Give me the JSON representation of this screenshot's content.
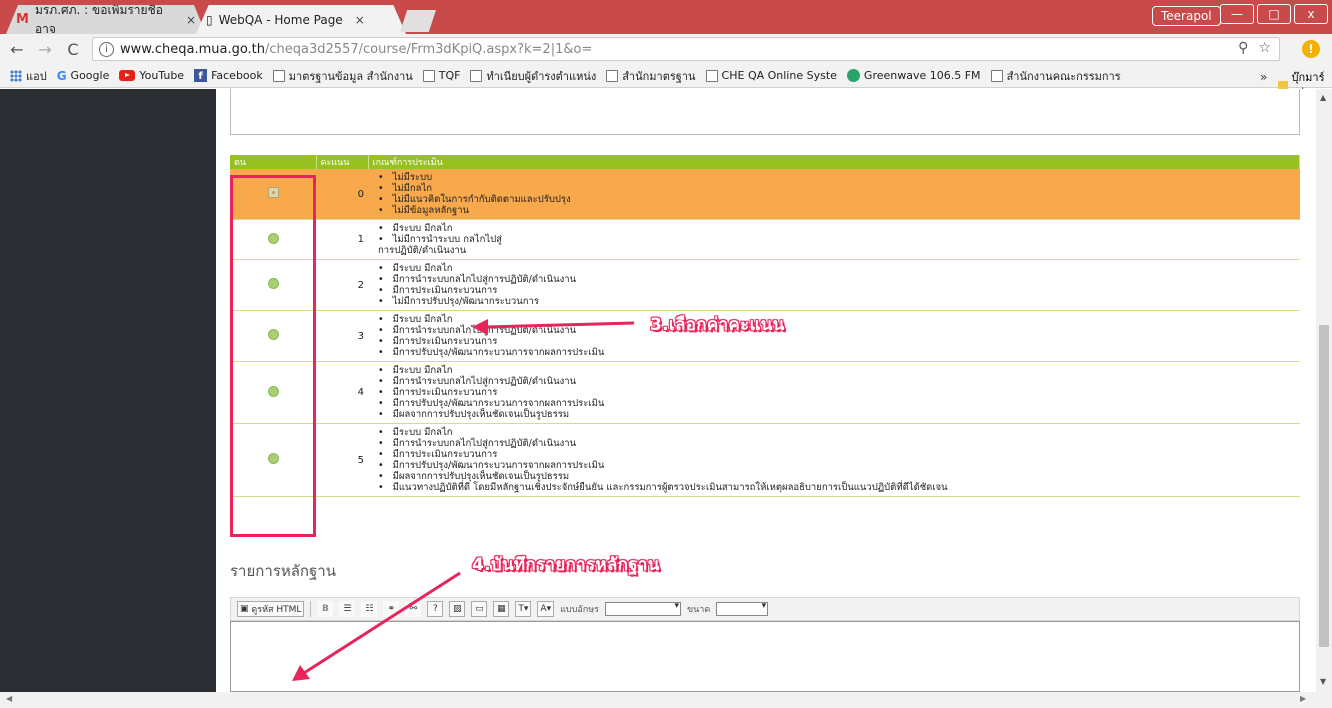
{
  "browser": {
    "tab_inactive_title": "มรภ.ศภ. : ขอเพิ่มรายชื่ออาจ",
    "tab_active_title": "WebQA - Home Page",
    "tab_close": "×",
    "user_name": "Teerapol",
    "win_min": "—",
    "win_max": "□",
    "win_close": "x",
    "url_host": "www.cheqa.mua.go.th",
    "url_path": "/cheqa3d2557/course/Frm3dKpiQ.aspx?k=2|1&o=",
    "bookmarks": [
      {
        "label": "แอป",
        "icon": "apps-grid-icon"
      },
      {
        "label": "Google",
        "icon": "google-icon"
      },
      {
        "label": "YouTube",
        "icon": "youtube-icon"
      },
      {
        "label": "Facebook",
        "icon": "facebook-icon"
      },
      {
        "label": "มาตรฐานข้อมูล สำนักงาน",
        "icon": "page-icon"
      },
      {
        "label": "TQF",
        "icon": "page-icon"
      },
      {
        "label": "ทำเนียบผู้ดำรงตำแหน่ง",
        "icon": "page-icon"
      },
      {
        "label": "สำนักมาตรฐาน",
        "icon": "page-icon"
      },
      {
        "label": "CHE QA Online Syste",
        "icon": "page-icon"
      },
      {
        "label": "Greenwave 106.5 FM",
        "icon": "greenwave-icon"
      },
      {
        "label": "สำนักงานคณะกรรมการ",
        "icon": "page-icon"
      }
    ],
    "bookmarks_more": "»",
    "bookmarks_other": "บุ๊กมาร์กอื่นๆ"
  },
  "table": {
    "headers": [
      "ตน",
      "คะแนน",
      "เกณฑ์การประเมิน"
    ],
    "rows": [
      {
        "score": "0",
        "selected": true,
        "items": [
          "ไม่มีระบบ",
          "ไม่มีกลไก",
          "ไม่มีแนวคิดในการกำกับติดตามและปรับปรุง",
          "ไม่มีข้อมูลหลักฐาน"
        ],
        "tail": ""
      },
      {
        "score": "1",
        "selected": false,
        "items": [
          "มีระบบ มีกลไก",
          "ไม่มีการนำระบบ กลไกไปสู่"
        ],
        "tail": "การปฏิบัติ/ดำเนินงาน"
      },
      {
        "score": "2",
        "selected": false,
        "items": [
          "มีระบบ มีกลไก",
          "มีการนำระบบกลไกไปสู่การปฏิบัติ/ดำเนินงาน",
          "มีการประเมินกระบวนการ",
          "ไม่มีการปรับปรุง/พัฒนากระบวนการ"
        ],
        "tail": ""
      },
      {
        "score": "3",
        "selected": false,
        "items": [
          "มีระบบ มีกลไก",
          "มีการนำระบบกลไกไปสู่การปฏิบัติ/ดำเนินงาน",
          "มีการประเมินกระบวนการ",
          "มีการปรับปรุง/พัฒนากระบวนการจากผลการประเมิน"
        ],
        "tail": ""
      },
      {
        "score": "4",
        "selected": false,
        "items": [
          "มีระบบ มีกลไก",
          "มีการนำระบบกลไกไปสู่การปฏิบัติ/ดำเนินงาน",
          "มีการประเมินกระบวนการ",
          "มีการปรับปรุง/พัฒนากระบวนการจากผลการประเมิน",
          "มีผลจากการปรับปรุงเห็นชัดเจนเป็นรูปธรรม"
        ],
        "tail": ""
      },
      {
        "score": "5",
        "selected": false,
        "items": [
          "มีระบบ มีกลไก",
          "มีการนำระบบกลไกไปสู่การปฏิบัติ/ดำเนินงาน",
          "มีการประเมินกระบวนการ",
          "มีการปรับปรุง/พัฒนากระบวนการจากผลการประเมิน",
          "มีผลจากการปรับปรุงเห็นชัดเจนเป็นรูปธรรม",
          "มีแนวทางปฏิบัติที่ดี โดยมีหลักฐานเชิงประจักษ์ยืนยัน และกรรมการผู้ตรวจประเมินสามารถให้เหตุผลอธิบายการเป็นแนวปฏิบัติที่ดีได้ชัดเจน"
        ],
        "tail": ""
      }
    ]
  },
  "evidence_label": "รายการหลักฐาน",
  "editor": {
    "html_button": "ดูรหัส HTML",
    "bold": "B",
    "font_label": "แบบอักษร",
    "size_label": "ขนาด"
  },
  "annotations": {
    "step3": "3.เลือกค่าคะแนน",
    "step4": "4.บันทึกรายการหลักฐาน"
  },
  "colors": {
    "accent_pink": "#e8245b",
    "header_green": "#97c11f",
    "selected_row": "#f8a94b",
    "sidebar": "#2b2f33"
  }
}
